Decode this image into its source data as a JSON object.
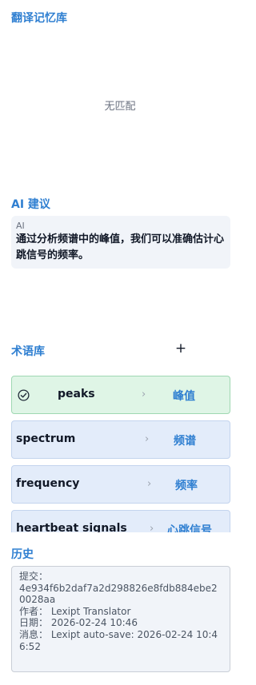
{
  "translation_memory": {
    "title": "翻译记忆库",
    "empty_text": "无匹配"
  },
  "ai_suggestion": {
    "title": "AI 建议",
    "label": "AI",
    "text": "通过分析频谱中的峰值，我们可以准确估计心跳信号的频率。"
  },
  "termbase": {
    "title": "术语库",
    "add_label": "+",
    "terms": [
      {
        "source": "peaks",
        "arrow": "›",
        "target": "峰值",
        "selected": true
      },
      {
        "source": "spectrum",
        "arrow": "›",
        "target": "频谱",
        "selected": false
      },
      {
        "source": "frequency",
        "arrow": "›",
        "target": "频率",
        "selected": false
      },
      {
        "source": "heartbeat signals",
        "arrow": "›",
        "target": "心跳信号",
        "selected": false
      }
    ]
  },
  "history": {
    "title": "历史",
    "commit_line1": "提交：",
    "commit_hash": "4e934f6b2daf7a2d298826e8fdb884ebe20028aa",
    "author": "作者：  Lexipt Translator",
    "date": "日期：  2026-02-24 10:46",
    "message": "消息：  Lexipt auto-save: 2026-02-24 10:46:52"
  },
  "colors": {
    "accent": "#2f7fd1",
    "term_card_bg": "#e3ecfa",
    "term_card_active_bg": "#dff5e6"
  }
}
